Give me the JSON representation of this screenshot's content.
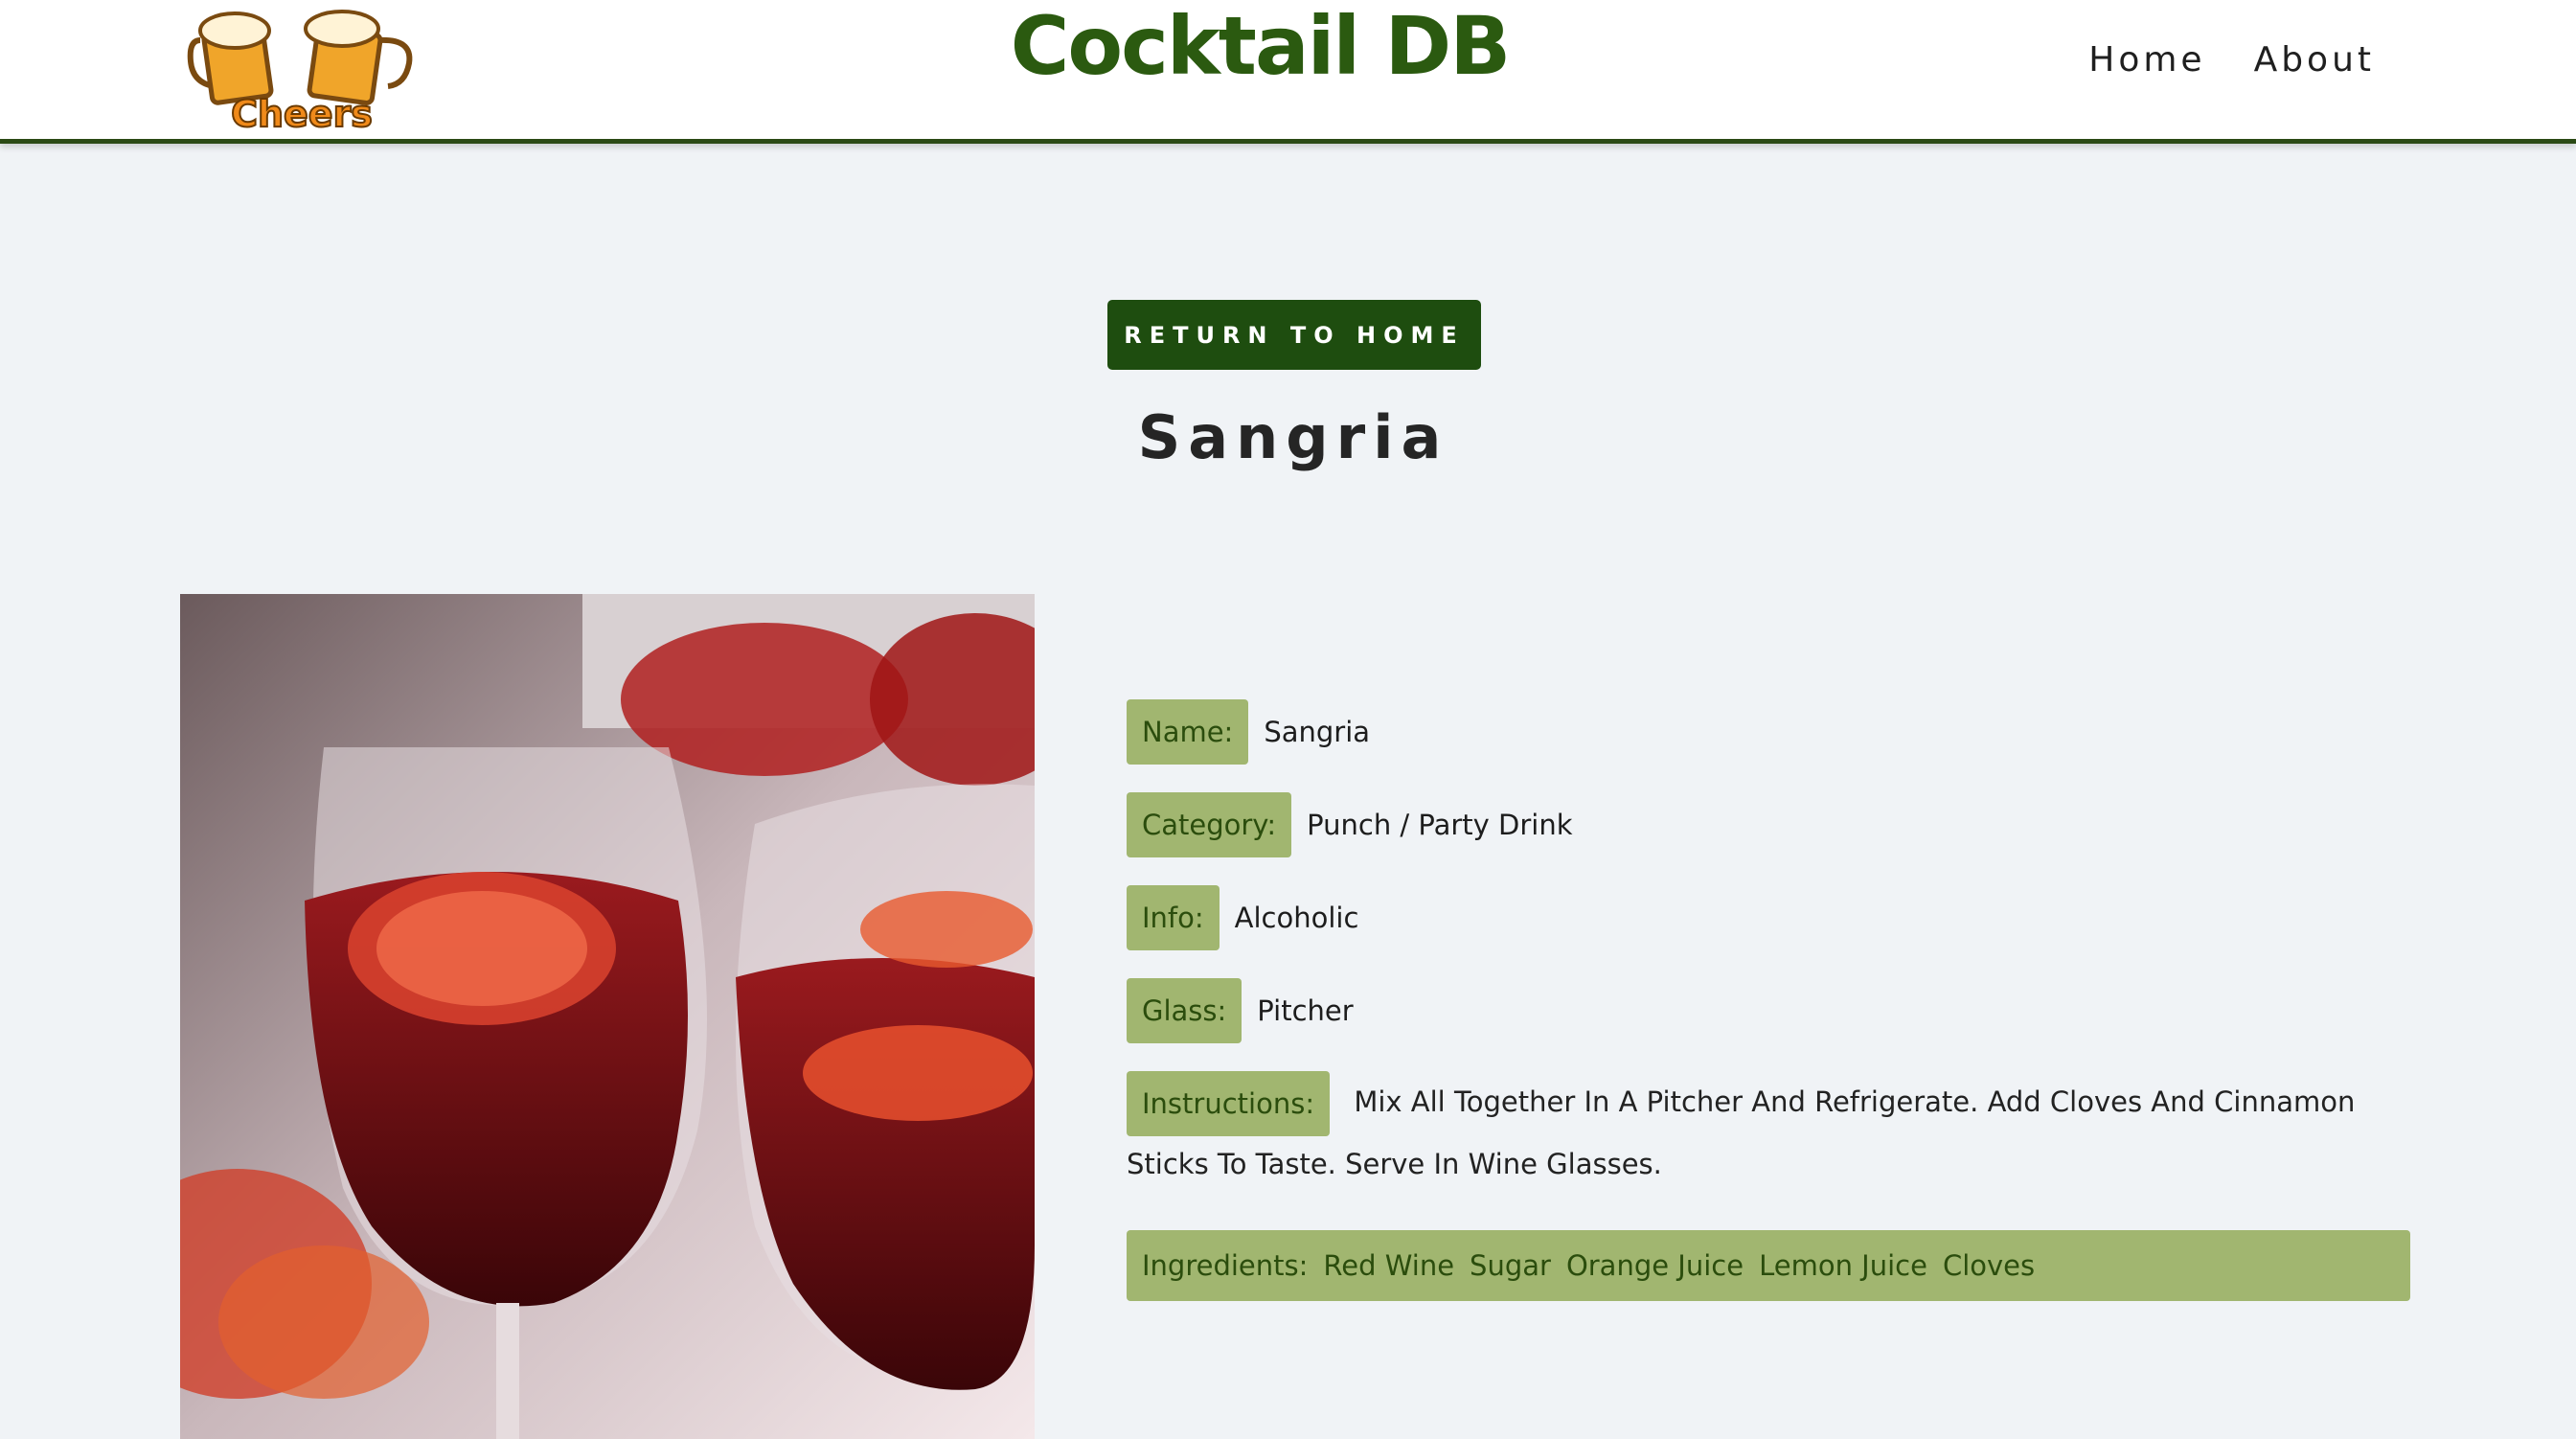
{
  "header": {
    "logo_text": "Cheers",
    "site_title": "Cocktail DB",
    "nav": [
      {
        "label": "Home"
      },
      {
        "label": "About"
      }
    ]
  },
  "return_button": {
    "label": "RETURN TO HOME"
  },
  "drink": {
    "title": "Sangria",
    "fields": {
      "name": {
        "label": "Name:",
        "value": "Sangria"
      },
      "category": {
        "label": "Category:",
        "value": "Punch / Party Drink"
      },
      "info": {
        "label": "Info:",
        "value": "Alcoholic"
      },
      "glass": {
        "label": "Glass:",
        "value": "Pitcher"
      },
      "instructions": {
        "label": "Instructions:",
        "value": "Mix All Together In A Pitcher And Refrigerate. Add Cloves And Cinnamon Sticks To Taste. Serve In Wine Glasses."
      }
    },
    "ingredients": {
      "label": "Ingredients:",
      "items": [
        "Red Wine",
        "Sugar",
        "Orange Juice",
        "Lemon Juice",
        "Cloves"
      ]
    }
  },
  "colors": {
    "brand_green": "#2b5a10",
    "button_green": "#1e4d0f",
    "label_bg": "#a1b670",
    "page_bg": "#f0f3f6"
  }
}
